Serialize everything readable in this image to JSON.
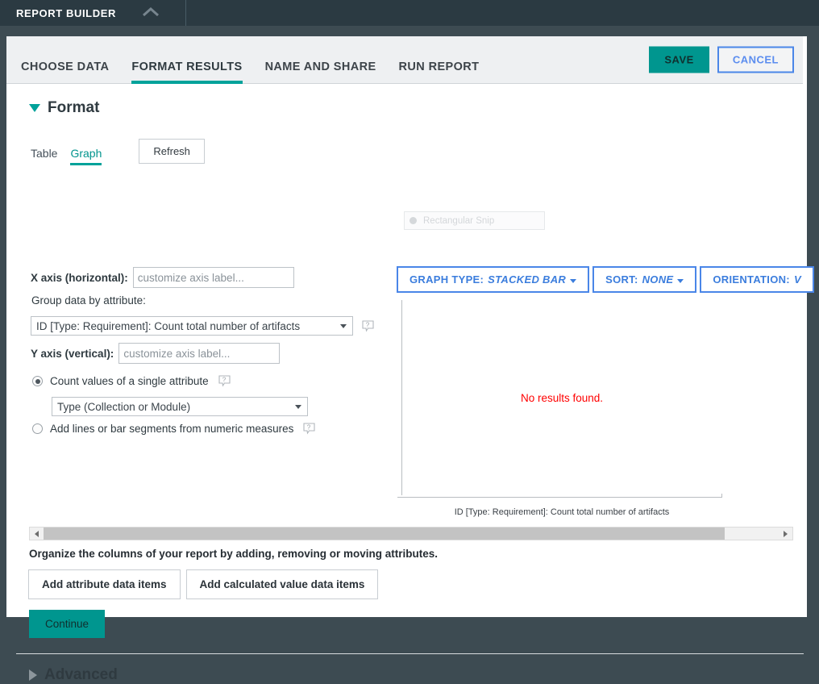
{
  "appbar": {
    "title": "REPORT BUILDER",
    "collapse_icon": "chevron-up-icon"
  },
  "wizard": {
    "tabs": [
      {
        "label": "CHOOSE DATA",
        "active": false
      },
      {
        "label": "FORMAT RESULTS",
        "active": true
      },
      {
        "label": "NAME AND SHARE",
        "active": false
      },
      {
        "label": "RUN REPORT",
        "active": false
      }
    ],
    "save_label": "SAVE",
    "cancel_label": "CANCEL"
  },
  "format": {
    "heading": "Format",
    "expanded_icon": "triangle-down-icon",
    "view_tabs": [
      {
        "label": "Table",
        "active": false
      },
      {
        "label": "Graph",
        "active": true
      }
    ],
    "refresh_label": "Refresh",
    "x_axis": {
      "label": "X axis (horizontal):",
      "input_value": "",
      "input_placeholder": "customize axis label...",
      "group_label": "Group data by attribute:",
      "group_value": "ID [Type: Requirement]: Count total number of artifacts",
      "help_icon": "help-question-icon"
    },
    "y_axis": {
      "label": "Y axis (vertical):",
      "input_value": "",
      "input_placeholder": "customize axis label...",
      "option_count_label": "Count values of a single attribute",
      "option_count_selected": true,
      "count_attribute_value": "Type (Collection or Module)",
      "option_measures_label": "Add lines or bar segments from numeric measures",
      "option_measures_selected": false,
      "help_icon": "help-question-icon"
    }
  },
  "snip_overlay": {
    "label": "Rectangular Snip"
  },
  "graph": {
    "buttons": [
      {
        "prefix": "GRAPH TYPE:",
        "value": "STACKED BAR"
      },
      {
        "prefix": "SORT:",
        "value": "NONE"
      },
      {
        "prefix": "ORIENTATION:",
        "value": "V"
      }
    ],
    "empty_message": "No results found.",
    "x_axis_caption": "ID [Type: Requirement]: Count total number of artifacts"
  },
  "chart_data": {
    "type": "bar",
    "title": "",
    "xlabel": "ID [Type: Requirement]: Count total number of artifacts",
    "ylabel": "",
    "categories": [],
    "values": [],
    "series": [],
    "grid": false,
    "legend": "none",
    "empty_message": "No results found.",
    "graph_type": "STACKED BAR",
    "sort": "NONE",
    "orientation": "V"
  },
  "columns": {
    "scroll_left_icon": "arrow-left-icon",
    "scroll_right_icon": "arrow-right-icon",
    "organize_text": "Organize the columns of your report by adding, removing or moving attributes.",
    "add_attribute_label": "Add attribute data items",
    "add_calculated_label": "Add calculated value data items",
    "continue_label": "Continue"
  },
  "advanced": {
    "heading": "Advanced",
    "collapsed_icon": "triangle-right-icon"
  }
}
